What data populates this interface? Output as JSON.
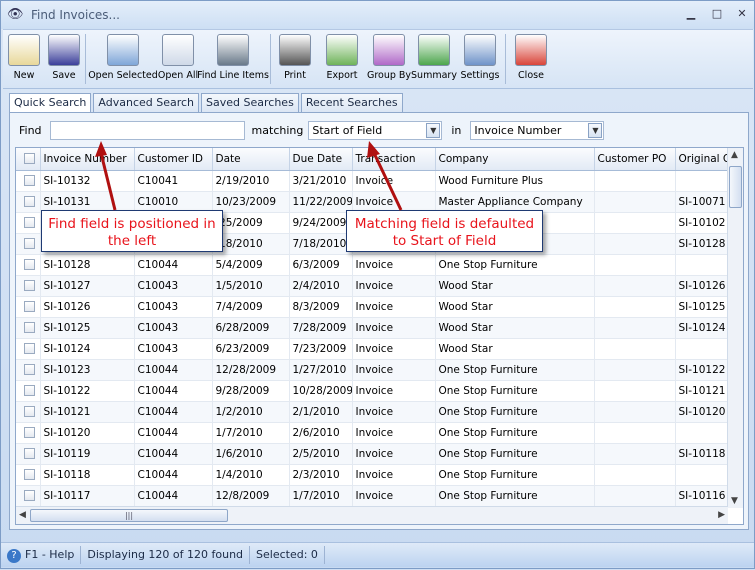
{
  "window": {
    "title": "Find Invoices...",
    "icon": "binoculars-icon"
  },
  "toolbar": [
    {
      "label": "New",
      "icon": "new-document-icon"
    },
    {
      "label": "Save",
      "icon": "floppy-disk-icon"
    },
    {
      "label": "Open Selected",
      "icon": "open-selected-icon"
    },
    {
      "label": "Open All",
      "icon": "open-all-icon"
    },
    {
      "label": "Find Line Items",
      "icon": "binoculars-icon"
    },
    {
      "label": "Print",
      "icon": "printer-icon"
    },
    {
      "label": "Export",
      "icon": "export-icon"
    },
    {
      "label": "Group By",
      "icon": "group-by-icon"
    },
    {
      "label": "Summary",
      "icon": "summary-icon"
    },
    {
      "label": "Settings",
      "icon": "settings-icon"
    },
    {
      "label": "Close",
      "icon": "close-window-icon"
    }
  ],
  "tabs": [
    {
      "label": "Quick Search",
      "active": true
    },
    {
      "label": "Advanced Search"
    },
    {
      "label": "Saved Searches"
    },
    {
      "label": "Recent Searches"
    }
  ],
  "find": {
    "label": "Find",
    "value": "",
    "matching_label": "matching",
    "matching_value": "Start of Field",
    "in_label": "in",
    "in_value": "Invoice Number"
  },
  "grid": {
    "columns": [
      "Invoice Number",
      "Customer ID",
      "Date",
      "Due Date",
      "Transaction",
      "Company",
      "Customer PO",
      "Original Or"
    ],
    "rows": [
      [
        "SI-10132",
        "C10041",
        "2/19/2010",
        "3/21/2010",
        "Invoice",
        "Wood Furniture Plus",
        "",
        ""
      ],
      [
        "SI-10131",
        "C10010",
        "10/23/2009",
        "11/22/2009",
        "Invoice",
        "Master Appliance Company",
        "",
        "SI-10071"
      ],
      [
        "",
        "",
        "/25/2009",
        "9/24/2009",
        "",
        "r",
        "",
        "SI-10102"
      ],
      [
        "",
        "",
        "/18/2010",
        "7/18/2010",
        "",
        "",
        "",
        "SI-10128"
      ],
      [
        "SI-10128",
        "C10044",
        "5/4/2009",
        "6/3/2009",
        "Invoice",
        "One Stop Furniture",
        "",
        ""
      ],
      [
        "SI-10127",
        "C10043",
        "1/5/2010",
        "2/4/2010",
        "Invoice",
        "Wood Star",
        "",
        "SI-10126"
      ],
      [
        "SI-10126",
        "C10043",
        "7/4/2009",
        "8/3/2009",
        "Invoice",
        "Wood Star",
        "",
        "SI-10125"
      ],
      [
        "SI-10125",
        "C10043",
        "6/28/2009",
        "7/28/2009",
        "Invoice",
        "Wood Star",
        "",
        "SI-10124"
      ],
      [
        "SI-10124",
        "C10043",
        "6/23/2009",
        "7/23/2009",
        "Invoice",
        "Wood Star",
        "",
        ""
      ],
      [
        "SI-10123",
        "C10044",
        "12/28/2009",
        "1/27/2010",
        "Invoice",
        "One Stop Furniture",
        "",
        "SI-10122"
      ],
      [
        "SI-10122",
        "C10044",
        "9/28/2009",
        "10/28/2009",
        "Invoice",
        "One Stop Furniture",
        "",
        "SI-10121"
      ],
      [
        "SI-10121",
        "C10044",
        "1/2/2010",
        "2/1/2010",
        "Invoice",
        "One Stop Furniture",
        "",
        "SI-10120"
      ],
      [
        "SI-10120",
        "C10044",
        "1/7/2010",
        "2/6/2010",
        "Invoice",
        "One Stop Furniture",
        "",
        ""
      ],
      [
        "SI-10119",
        "C10044",
        "1/6/2010",
        "2/5/2010",
        "Invoice",
        "One Stop Furniture",
        "",
        "SI-10118"
      ],
      [
        "SI-10118",
        "C10044",
        "1/4/2010",
        "2/3/2010",
        "Invoice",
        "One Stop Furniture",
        "",
        ""
      ],
      [
        "SI-10117",
        "C10044",
        "12/8/2009",
        "1/7/2010",
        "Invoice",
        "One Stop Furniture",
        "",
        "SI-10116"
      ]
    ]
  },
  "callouts": [
    "Find field is positioned in the left",
    "Matching field is defaulted to Start of Field"
  ],
  "status": {
    "help": "F1 - Help",
    "displaying": "Displaying 120 of 120 found",
    "selected": "Selected: 0"
  },
  "colors": {
    "callout_text": "#e8131b",
    "arrow": "#b01010"
  }
}
